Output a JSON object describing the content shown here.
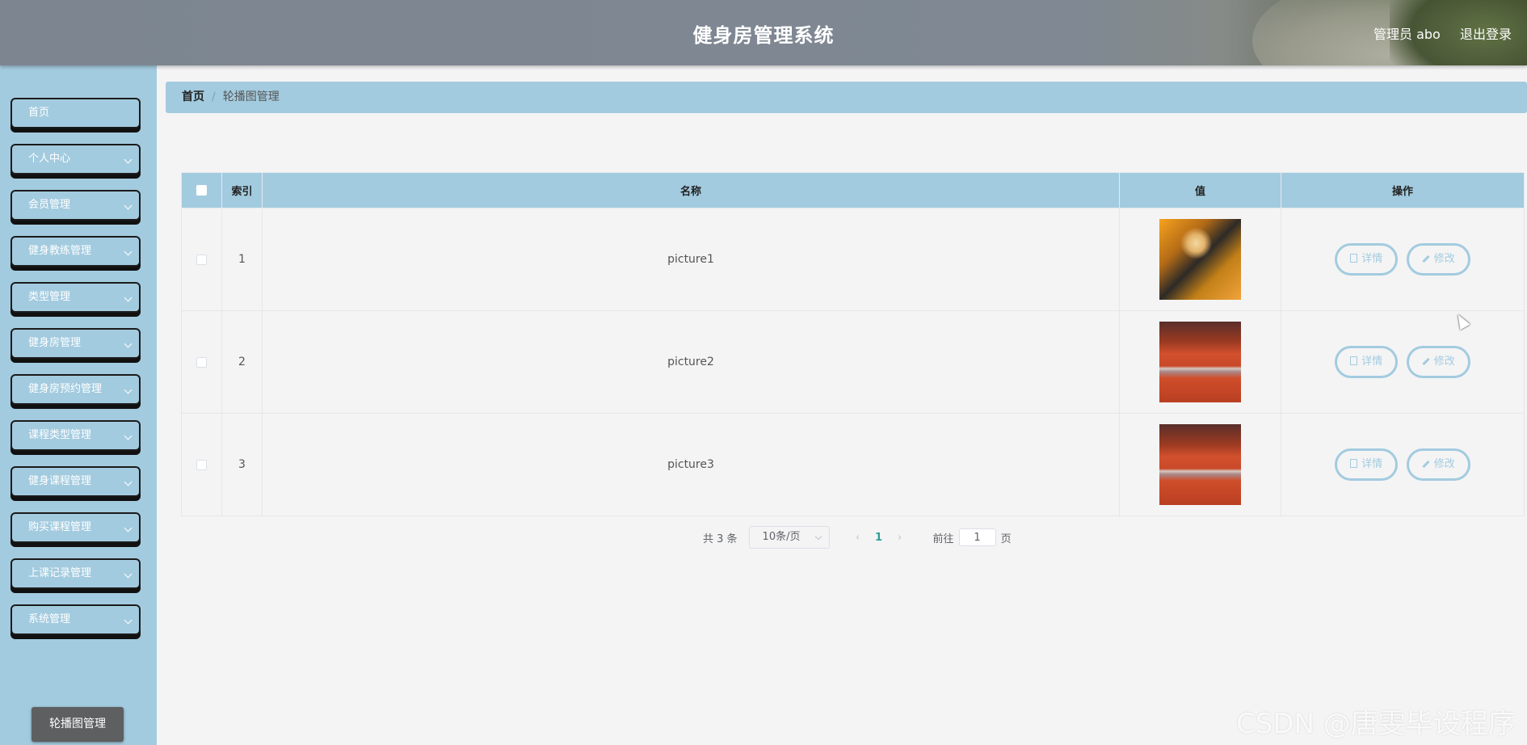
{
  "header": {
    "title": "健身房管理系统",
    "user_role": "管理员 abo",
    "logout": "退出登录"
  },
  "sidebar": {
    "items": [
      {
        "label": "首页",
        "expandable": false
      },
      {
        "label": "个人中心",
        "expandable": true
      },
      {
        "label": "会员管理",
        "expandable": true
      },
      {
        "label": "健身教练管理",
        "expandable": true
      },
      {
        "label": "类型管理",
        "expandable": true
      },
      {
        "label": "健身房管理",
        "expandable": true
      },
      {
        "label": "健身房预约管理",
        "expandable": true
      },
      {
        "label": "课程类型管理",
        "expandable": true
      },
      {
        "label": "健身课程管理",
        "expandable": true
      },
      {
        "label": "购买课程管理",
        "expandable": true
      },
      {
        "label": "上课记录管理",
        "expandable": true
      },
      {
        "label": "系统管理",
        "expandable": true
      }
    ],
    "active_submenu": "轮播图管理"
  },
  "breadcrumb": {
    "home": "首页",
    "current": "轮播图管理"
  },
  "table": {
    "columns": [
      "索引",
      "名称",
      "值",
      "操作"
    ],
    "rows": [
      {
        "index": "1",
        "name": "picture1",
        "image": "gym-machine-photo"
      },
      {
        "index": "2",
        "name": "picture2",
        "image": "pushup-photo"
      },
      {
        "index": "3",
        "name": "picture3",
        "image": "pushup-photo"
      }
    ],
    "actions": {
      "detail": "详情",
      "edit": "修改"
    }
  },
  "pagination": {
    "total": "共 3 条",
    "page_size": "10条/页",
    "current_page": "1",
    "goto_label": "前往",
    "goto_value": "1",
    "page_suffix": "页"
  },
  "watermark": "CSDN @唐雯毕设程序",
  "colors": {
    "accent": "#a3cbdf",
    "page_background": "#f4f4f5",
    "active_submenu": "#5e5f61"
  }
}
